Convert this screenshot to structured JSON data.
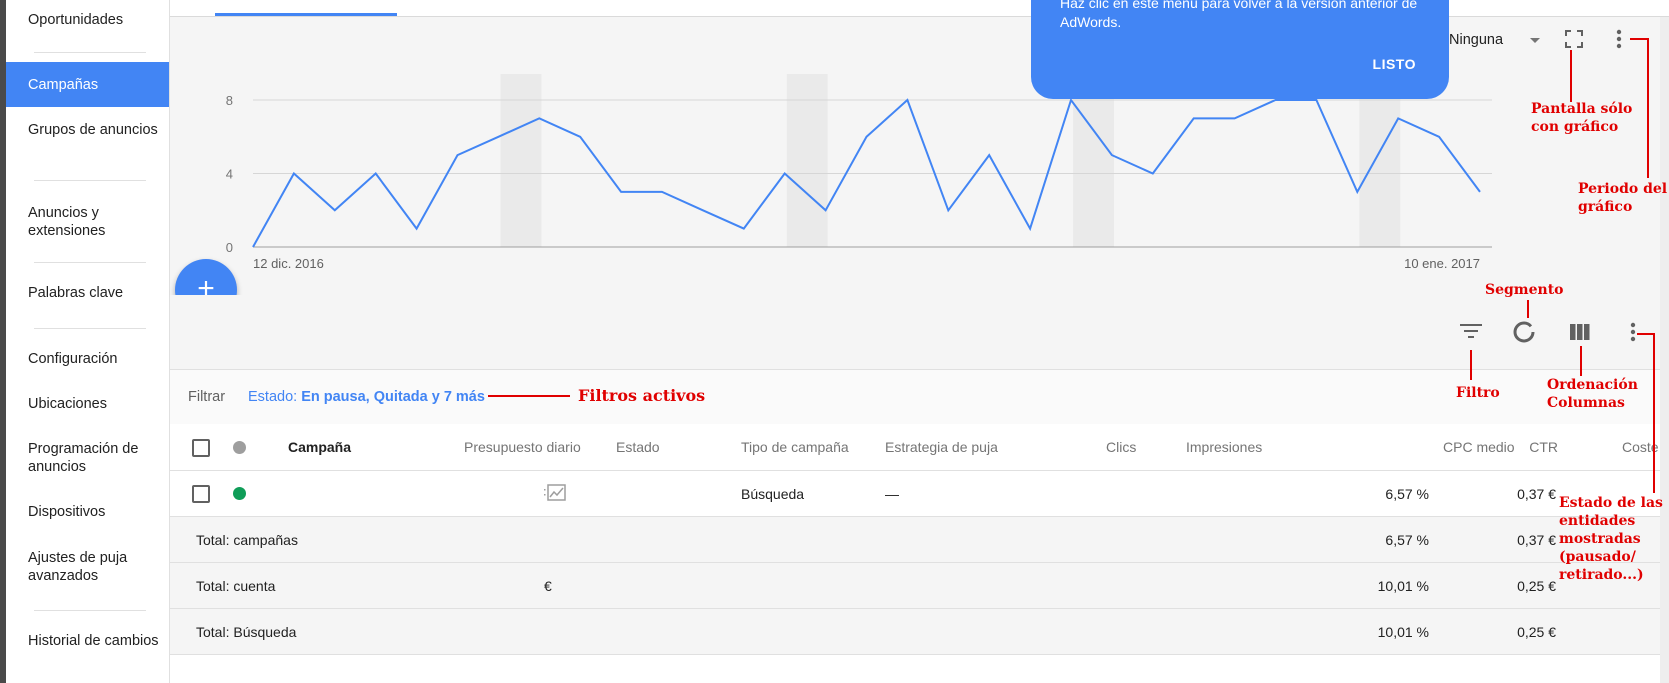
{
  "sidebar": {
    "items": [
      {
        "label": "Oportunidades"
      },
      {
        "label": "Campañas"
      },
      {
        "label": "Grupos de anuncios"
      },
      {
        "label": "Anuncios y extensiones"
      },
      {
        "label": "Palabras clave"
      },
      {
        "label": "Configuración"
      },
      {
        "label": "Ubicaciones"
      },
      {
        "label": "Programación de anuncios"
      },
      {
        "label": "Dispositivos"
      },
      {
        "label": "Ajustes de puja avanzados"
      },
      {
        "label": "Historial de cambios"
      }
    ],
    "selected": "Campañas"
  },
  "tooltip": {
    "text": "Haz clic en este menú para volver a la versión anterior de AdWords.",
    "button": "LISTO"
  },
  "chart_controls": {
    "segment_select": "Ninguna"
  },
  "chart_data": {
    "type": "line",
    "y_ticks": [
      "0",
      "4",
      "8"
    ],
    "ylim": [
      0,
      8
    ],
    "x_start_label": "12 dic. 2016",
    "x_end_label": "10 ene. 2017",
    "x": [
      "2016-12-12",
      "2016-12-13",
      "2016-12-14",
      "2016-12-15",
      "2016-12-16",
      "2016-12-17",
      "2016-12-18",
      "2016-12-19",
      "2016-12-20",
      "2016-12-21",
      "2016-12-22",
      "2016-12-23",
      "2016-12-24",
      "2016-12-25",
      "2016-12-26",
      "2016-12-27",
      "2016-12-28",
      "2016-12-29",
      "2016-12-30",
      "2016-12-31",
      "2017-01-01",
      "2017-01-02",
      "2017-01-03",
      "2017-01-04",
      "2017-01-05",
      "2017-01-06",
      "2017-01-07",
      "2017-01-08",
      "2017-01-09",
      "2017-01-10"
    ],
    "series": [
      {
        "values": [
          0,
          4,
          2,
          4,
          1,
          5,
          6,
          7,
          6,
          3,
          3,
          2,
          1,
          4,
          2,
          6,
          8,
          2,
          5,
          1,
          8,
          5,
          4,
          7,
          7,
          8,
          8,
          3,
          7,
          6,
          3
        ]
      }
    ],
    "weekend_bands": [
      [
        "2016-12-17",
        "2016-12-18"
      ],
      [
        "2016-12-24",
        "2016-12-25"
      ],
      [
        "2016-12-31",
        "2017-01-01"
      ],
      [
        "2017-01-07",
        "2017-01-08"
      ]
    ],
    "line_color": "#4285f4",
    "grid": true
  },
  "filter": {
    "label": "Filtrar",
    "prefix": "Estado: ",
    "value": "En pausa, Quitada y 7 más"
  },
  "table": {
    "columns": [
      "Campaña",
      "Presupuesto diario",
      "Estado",
      "Tipo de campaña",
      "Estrategia de puja",
      "Clics",
      "Impresiones",
      "CTR",
      "CPC medio",
      "Coste"
    ],
    "rows": [
      {
        "type": "Búsqueda",
        "strategy": "—",
        "ctr": "6,57 %",
        "cpc": "0,37 €",
        "status_color": "#0f9d58"
      }
    ],
    "totals": [
      {
        "label": "Total: campañas",
        "budget": "",
        "ctr": "6,57 %",
        "cpc": "0,37 €"
      },
      {
        "label": "Total: cuenta",
        "budget": "€",
        "ctr": "10,01 %",
        "cpc": "0,25 €"
      },
      {
        "label": "Total: Búsqueda",
        "budget": "",
        "ctr": "10,01 %",
        "cpc": "0,25 €"
      }
    ]
  },
  "annotations": {
    "fullscreen": "Pantalla sólo\ncon gráfico",
    "period": "Periodo del\ngráfico",
    "segment": "Segmento",
    "filter": "Filtro",
    "columns": "Ordenación\nColumnas",
    "active_filters": "Filtros activos",
    "entity_status": "Estado de las\nentidades\nmostradas\n(pausado/\nretirado...)"
  },
  "colors": {
    "accent": "#4285f4",
    "annotation": "#e00000",
    "enabled_dot": "#0f9d58",
    "header_dot": "#9e9e9e"
  }
}
